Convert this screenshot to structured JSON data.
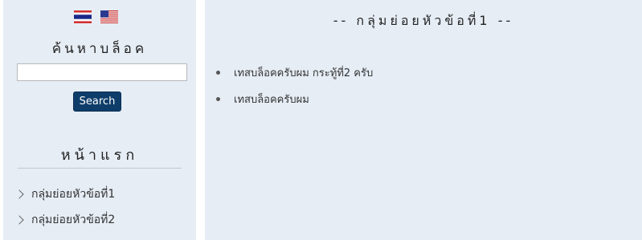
{
  "sidebar": {
    "flags": [
      {
        "name": "thai-flag-icon"
      },
      {
        "name": "us-flag-icon"
      }
    ],
    "search_heading": "ค้นหาบล็อค",
    "search_input_value": "",
    "search_button_label": "Search",
    "home_title": "หน้าแรก",
    "categories": [
      {
        "label": "กลุ่มย่อยหัวข้อที่1"
      },
      {
        "label": "กลุ่มย่อยหัวข้อที่2"
      }
    ]
  },
  "main": {
    "title": "-- กลุ่มย่อยหัวข้อที่1 --",
    "posts": [
      {
        "label": "เทสบล็อคครับผม กระทู้ที่2 ครับ"
      },
      {
        "label": "เทสบล็อคครับผม"
      }
    ]
  },
  "colors": {
    "panel_bg": "#e6edf5",
    "button_bg": "#0e3d6a"
  }
}
